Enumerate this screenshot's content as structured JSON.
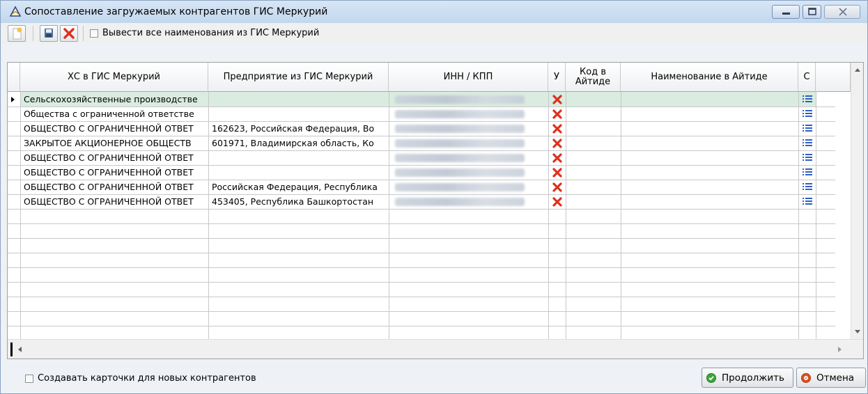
{
  "window": {
    "title": "Сопоставление загружаемых контрагентов  ГИС Меркурий"
  },
  "toolbar": {
    "show_all_names_label": "Вывести все наименования из ГИС Меркурий"
  },
  "grid": {
    "columns": [
      "ХС  в ГИС Меркурий",
      "Предприятие из ГИС Меркурий",
      "ИНН / КПП",
      "У",
      "Код в Айтиде",
      "Наименование в Айтиде",
      "С"
    ],
    "rows": [
      {
        "hs": "Сельскохозяйственные производстве",
        "enterprise": "",
        "inn_kpp": "",
        "selected": true
      },
      {
        "hs": "Общества с ограниченной ответстве",
        "enterprise": "",
        "inn_kpp": ""
      },
      {
        "hs": "ОБЩЕСТВО С ОГРАНИЧЕННОЙ ОТВЕТ",
        "enterprise": "162623, Российская Федерация, Во",
        "inn_kpp": ""
      },
      {
        "hs": "ЗАКРЫТОЕ АКЦИОНЕРНОЕ ОБЩЕСТВ",
        "enterprise": "601971, Владимирская область, Ко",
        "inn_kpp": ""
      },
      {
        "hs": "ОБЩЕСТВО С ОГРАНИЧЕННОЙ ОТВЕТ",
        "enterprise": "",
        "inn_kpp": ""
      },
      {
        "hs": "ОБЩЕСТВО С ОГРАНИЧЕННОЙ ОТВЕТ",
        "enterprise": "",
        "inn_kpp": ""
      },
      {
        "hs": "ОБЩЕСТВО С ОГРАНИЧЕННОЙ ОТВЕТ",
        "enterprise": "Российская Федерация, Республика",
        "inn_kpp": ""
      },
      {
        "hs": "ОБЩЕСТВО С ОГРАНИЧЕННОЙ ОТВЕТ",
        "enterprise": "453405, Республика Башкортостан",
        "inn_kpp": ""
      }
    ]
  },
  "footer": {
    "create_cards_label": "Создавать карточки для новых контрагентов",
    "continue_label": "Продолжить",
    "cancel_label": "Отмена"
  },
  "colors": {
    "selected_row": "#d9ecdf",
    "delete_icon": "#e0301e",
    "list_icon": "#2f5fc4",
    "continue_icon": "#3aa63a",
    "cancel_icon": "#e0501e"
  }
}
